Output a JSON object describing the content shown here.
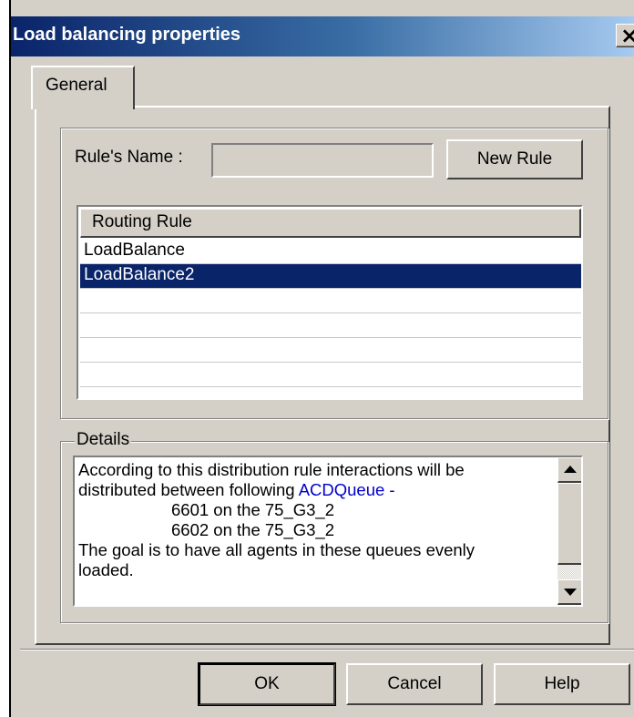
{
  "window": {
    "title": "Load balancing properties",
    "close_glyph": "✕"
  },
  "tabs": [
    {
      "label": "General"
    }
  ],
  "form": {
    "rule_name_label": "Rule's Name :",
    "rule_name_value": "",
    "new_rule_button": "New Rule"
  },
  "routing_list": {
    "header": "Routing Rule",
    "items": [
      "LoadBalance",
      "LoadBalance2"
    ],
    "selected_index": 1
  },
  "details": {
    "legend": "Details",
    "line1": "According to this distribution rule interactions will be",
    "line2_prefix": "distributed between following ",
    "line2_link": "ACDQueue -",
    "line3": "6601 on the 75_G3_2",
    "line4": "6602 on the 75_G3_2",
    "line5": "The goal is to have all agents in these queues evenly",
    "line6": "loaded."
  },
  "buttons": {
    "ok": "OK",
    "cancel": "Cancel",
    "help": "Help"
  },
  "icons": {
    "close": "close-icon",
    "scroll_up": "scroll-up-arrow-icon",
    "scroll_down": "scroll-down-arrow-icon"
  },
  "colors": {
    "titlebar_start": "#0a246a",
    "titlebar_end": "#a6caf0",
    "selection": "#0a246a",
    "link": "#0000cc",
    "face": "#d4d0c8"
  }
}
